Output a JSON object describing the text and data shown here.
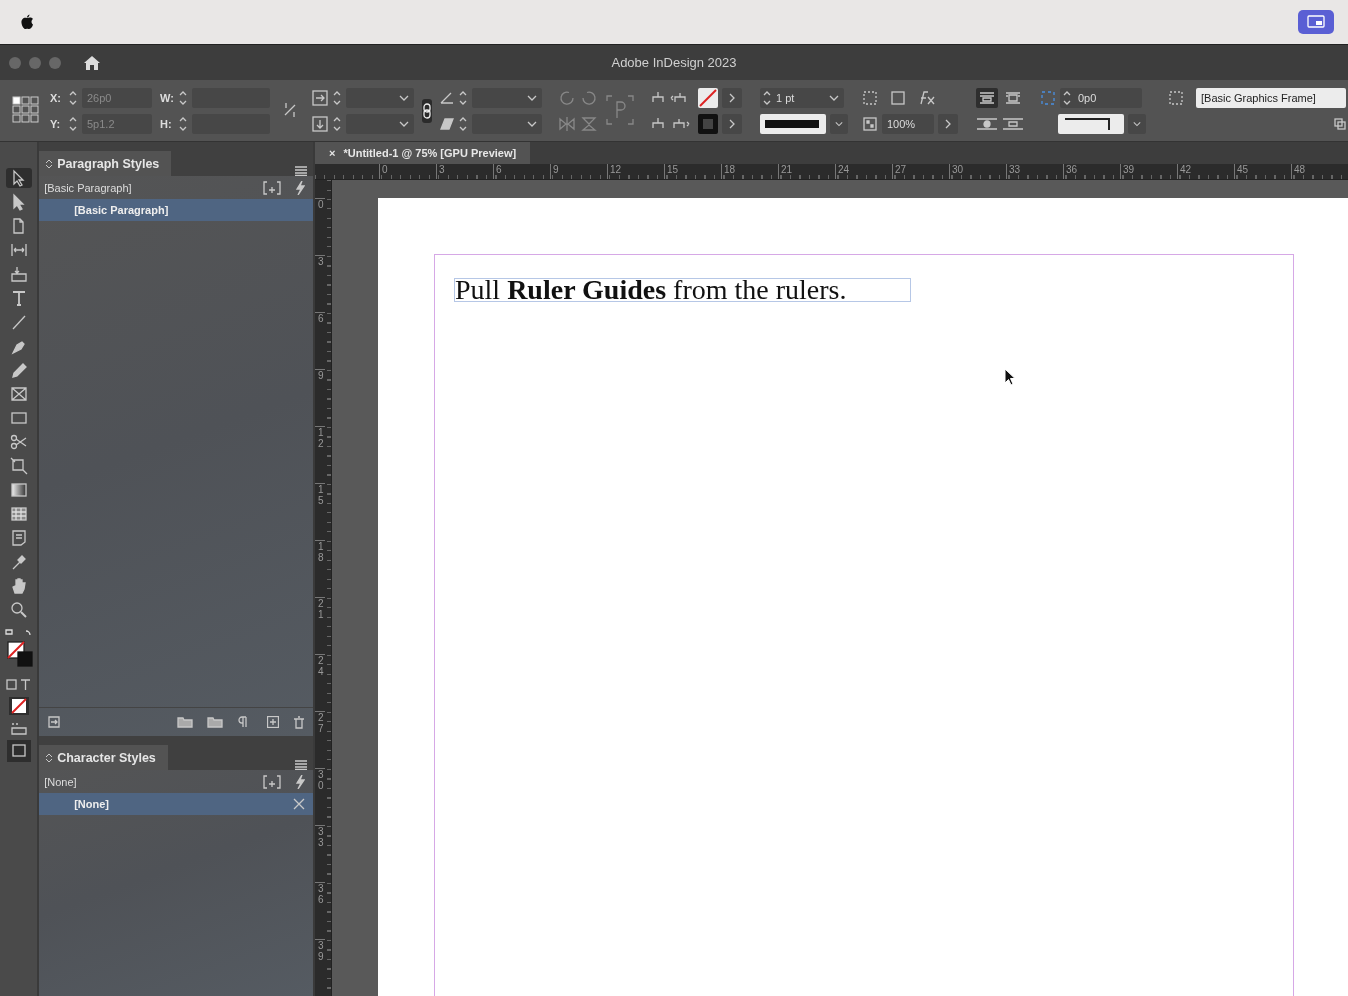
{
  "window": {
    "title": "Adobe InDesign 2023"
  },
  "control_panel": {
    "fields": [
      {
        "label": "X:",
        "value": "26p0",
        "disabled": true
      },
      {
        "label": "Y:",
        "value": "5p1.2",
        "disabled": true
      },
      {
        "label": "W:"
      },
      {
        "label": "H:"
      }
    ],
    "constrain_proportions": true,
    "stroke_weight": "1 pt",
    "opacity": "100%",
    "corner_size": "0p0",
    "object_style": "[Basic Graphics Frame]",
    "text_wrap": [
      {
        "selected": true
      },
      {
        "selected": false
      }
    ]
  },
  "tools": [
    {
      "kind": "selection",
      "selected": true
    },
    {
      "kind": "direct",
      "selected": false
    },
    {
      "kind": "page",
      "selected": false
    },
    {
      "kind": "gap",
      "selected": false
    },
    {
      "kind": "collector",
      "selected": false
    },
    {
      "kind": "type",
      "selected": false
    },
    {
      "kind": "line",
      "selected": false
    },
    {
      "kind": "pen",
      "selected": false
    },
    {
      "kind": "pencil",
      "selected": false
    },
    {
      "kind": "frame",
      "selected": false
    },
    {
      "kind": "rect",
      "selected": false
    },
    {
      "kind": "scissors",
      "selected": false
    },
    {
      "kind": "transform",
      "selected": false
    },
    {
      "kind": "gradient",
      "selected": false
    },
    {
      "kind": "feather",
      "selected": false
    },
    {
      "kind": "note",
      "selected": false
    },
    {
      "kind": "eyedropper",
      "selected": false
    },
    {
      "kind": "hand",
      "selected": false
    },
    {
      "kind": "zoom",
      "selected": false
    }
  ],
  "paragraph_styles": {
    "title": "Paragraph Styles",
    "current": "[Basic Paragraph]",
    "styles": [
      {
        "label": "[Basic Paragraph]",
        "selected": true
      }
    ]
  },
  "character_styles": {
    "title": "Character Styles",
    "current": "[None]",
    "styles": [
      {
        "label": "[None]",
        "selected": true
      }
    ]
  },
  "document_tab": {
    "close": "×",
    "title": "*Untitled-1 @ 75% [GPU Preview]"
  },
  "horizontal_ruler": [
    "0",
    "3",
    "6",
    "9",
    "12",
    "15",
    "18",
    "21",
    "24",
    "27",
    "30",
    "33",
    "36",
    "39",
    "42",
    "45",
    "48"
  ],
  "vertical_ruler": [
    "0",
    "3",
    "6",
    "9",
    "12",
    "15",
    "18",
    "21",
    "24",
    "27",
    "30",
    "33",
    "36",
    "39"
  ],
  "page": {
    "text": "Pull **Ruler Guides** from the rulers."
  }
}
